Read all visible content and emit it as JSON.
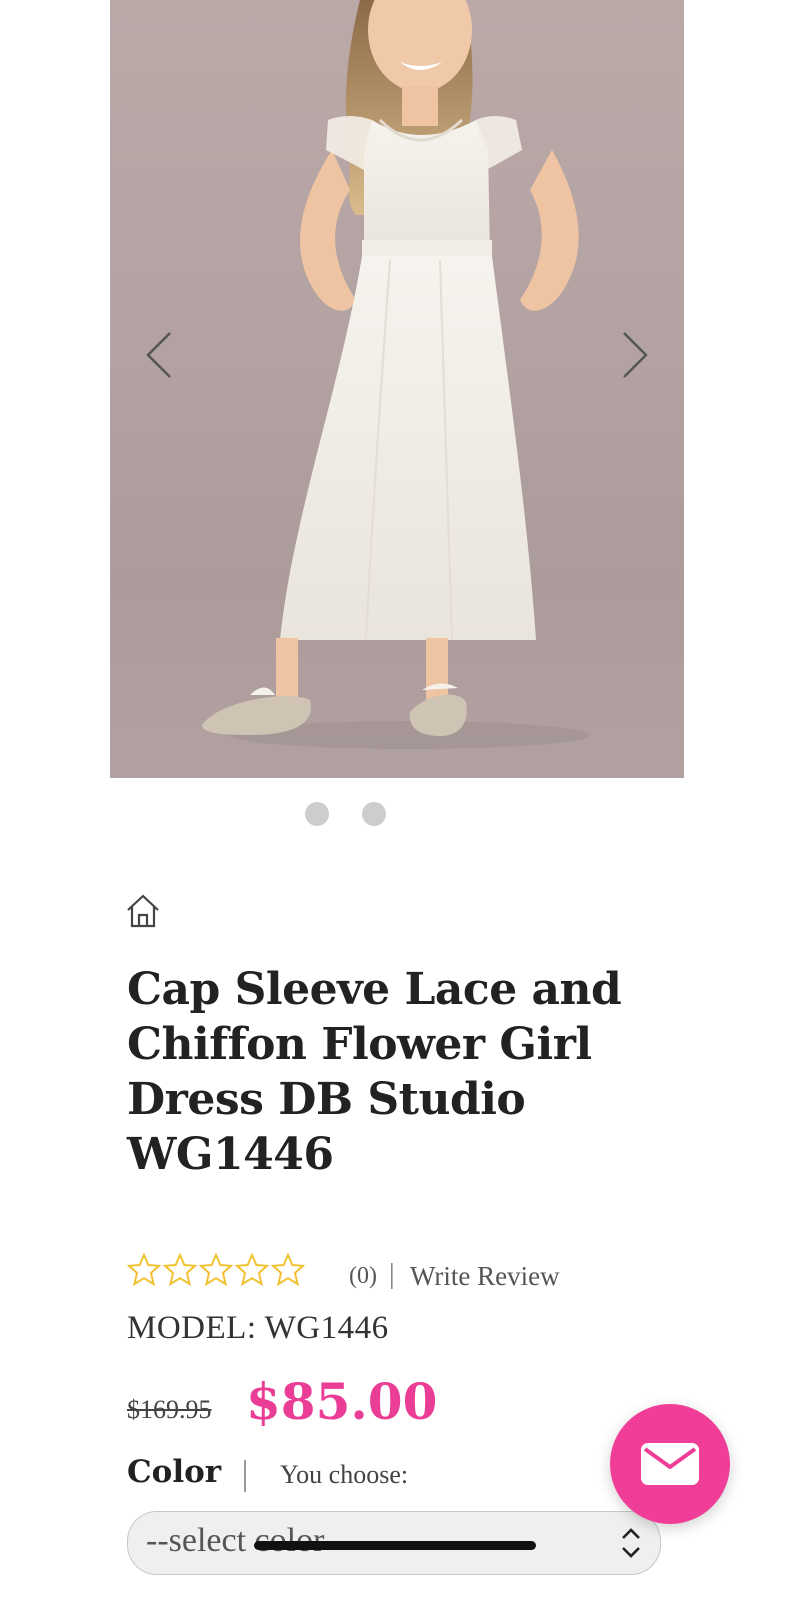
{
  "gallery": {
    "image_alt": "",
    "slide_count": 2,
    "active_slide": 1
  },
  "product": {
    "title": "Cap Sleeve Lace and Chiffon Flower Girl Dress DB Studio WG1446",
    "rating": {
      "stars_filled": 0,
      "stars_total": 5,
      "review_count_text": "(0)",
      "separator": "|",
      "write_review_label": "Write Review"
    },
    "model": {
      "label": "MODEL:",
      "value": "WG1446"
    },
    "price": {
      "original": "$169.95",
      "sale": "$85.00"
    },
    "color": {
      "label": "Color",
      "you_choose_label": "You choose:",
      "selected_value": "--select color--"
    }
  },
  "icons": {
    "home": "home-icon",
    "prev": "chevron-left-icon",
    "next": "chevron-right-icon",
    "star": "star-outline-icon",
    "select": "chevron-up-down-icon",
    "contact": "mail-icon"
  },
  "colors": {
    "accent_pink": "#ea3d95",
    "fab_pink": "#f03e98",
    "star_gold": "#f1c232",
    "text_dark": "#222222",
    "dot_gray": "#cdcdcd"
  }
}
